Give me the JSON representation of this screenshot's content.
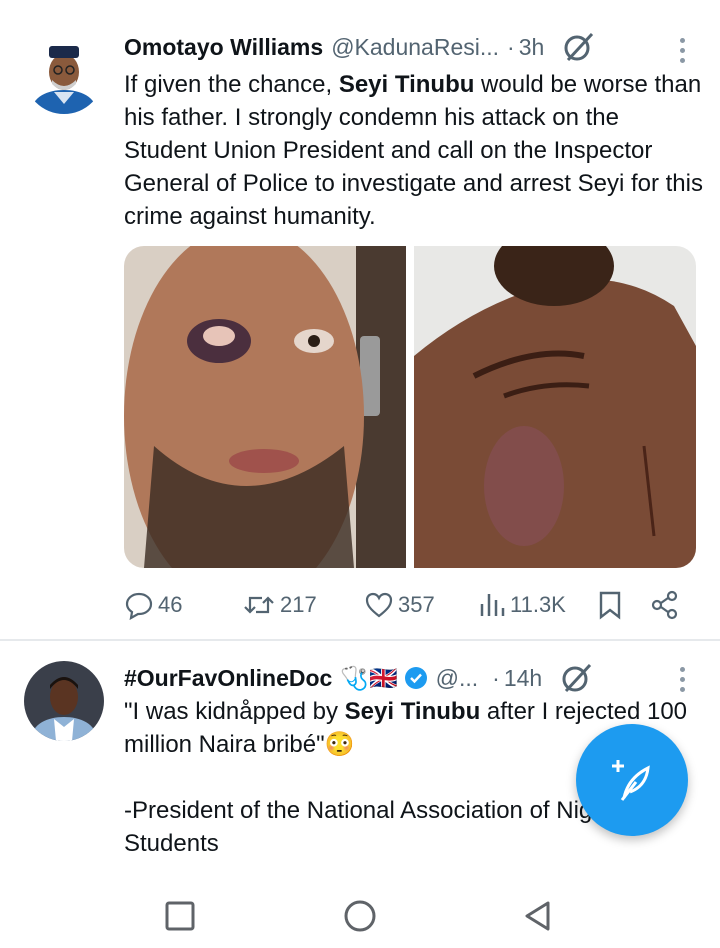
{
  "tweets": [
    {
      "author_name": "Omotayo Williams",
      "handle": "@KadunaResi...",
      "separator": "·",
      "time": "3h",
      "text_before": "If given the chance, ",
      "text_bold": "Seyi Tinubu",
      "text_after": " would be worse than his father. I strongly condemn his attack on the Student Union President and call on the Inspector General of Police to investigate and arrest Seyi for this crime against humanity.",
      "stats": {
        "replies": "46",
        "reposts": "217",
        "likes": "357",
        "views": "11.3K"
      }
    },
    {
      "author_name": "#OurFavOnlineDoc",
      "badges": "🩺🇬🇧",
      "handle": "@...",
      "separator": "·",
      "time": "14h",
      "text_before": "\"I was kidnåpped by ",
      "text_bold": "Seyi Tinubu",
      "text_after": " after I rejected 100 million Naira bribé\"😳",
      "text_line2": "-President of the National Association of Nigerian Students"
    }
  ],
  "colors": {
    "accent": "#1d9bf0",
    "muted": "#536471",
    "text": "#0f1419"
  },
  "icons": {
    "reply": "reply-icon",
    "repost": "repost-icon",
    "like": "heart-icon",
    "views": "views-icon",
    "bookmark": "bookmark-icon",
    "share": "share-icon",
    "grok": "grok-icon",
    "compose": "compose-post-icon"
  }
}
